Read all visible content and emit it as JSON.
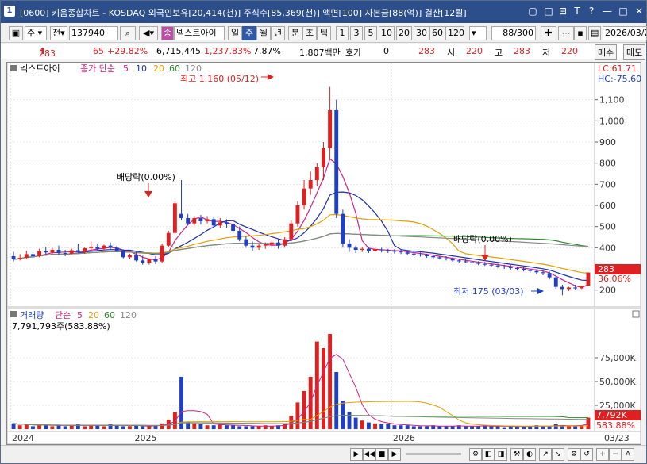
{
  "title_bar": {
    "window_number": "1",
    "title": "[0600] 키움종합차트 - KOSDAQ 외국인보유[20,414(천)] 주식수[85,369(천)] 액면[100] 자본금[88(억)] 결산[12월]",
    "buttons": [
      "▢",
      "□",
      "⊟",
      "T",
      "?",
      "—",
      "□",
      "✕"
    ]
  },
  "toolbar": {
    "type_label": "주",
    "market_label": "전",
    "code_value": "137940",
    "indicator_label": "종",
    "stock_name": "넥스트아이",
    "periods": [
      "일",
      "주",
      "월",
      "년",
      "분",
      "초",
      "틱"
    ],
    "selected_period": "주",
    "intervals": [
      "1",
      "3",
      "5",
      "10",
      "20",
      "30",
      "60",
      "120"
    ],
    "count_value": "88",
    "count_total": "/300",
    "date_value": "2026/03/2"
  },
  "quote_bar": {
    "price": "283",
    "change": "65",
    "change_pct": "+29.82%",
    "volume": "6,715,445",
    "volume_pct": "1,237.83%",
    "rate": "7.87%",
    "amount": "1,807백만",
    "hoga_label": "호가",
    "hoga_value": "0",
    "hoga_price": "283",
    "open_label": "시",
    "open_value": "220",
    "high_label": "고",
    "high_value": "283",
    "low_label": "저",
    "low_value": "220",
    "buy_label": "매수",
    "sell_label": "매도"
  },
  "price_panel": {
    "stock_label": "넥스트아이",
    "ma_label": "종가 단순",
    "ma_periods": [
      "5",
      "10",
      "20",
      "60",
      "120"
    ],
    "ma_colors": [
      "#cc2288",
      "#1b2fa8",
      "#e0a000",
      "#2a8a2a",
      "#888888"
    ],
    "high_annotation": "최고 1,160 (05/12)",
    "low_annotation": "최저 175 (03/03)",
    "dividend_annotation_1": "배당락(0.00%)",
    "dividend_annotation_2": "배당락(0.00%)",
    "lc_label": "LC:61.71",
    "hc_label": "HC:-75.60",
    "current_price": "283",
    "current_pct": "36.06%",
    "y_ticks": [
      "1,100",
      "1,000",
      "900",
      "800",
      "700",
      "600",
      "500",
      "400",
      "300",
      "200"
    ]
  },
  "volume_panel": {
    "label": "거래량",
    "ma_label": "단순",
    "ma_periods": [
      "5",
      "20",
      "60",
      "120"
    ],
    "volume_text": "7,791,793주(583.88%)",
    "y_ticks": [
      "75,000K",
      "50,000K",
      "25,000K"
    ],
    "current_volume": "7,792K",
    "current_pct": "583.88%"
  },
  "x_axis": {
    "labels": [
      "2024",
      "2025",
      "2026"
    ],
    "last_label": "03/23"
  },
  "chart_data": {
    "type": "candlestick",
    "x_labels": [
      "2024",
      "2025",
      "2026",
      "03/23"
    ],
    "ylim": [
      150,
      1200
    ],
    "price_ticks": [
      200,
      300,
      400,
      500,
      600,
      700,
      800,
      900,
      1000,
      1100
    ],
    "candles": [
      [
        0,
        360,
        380,
        345,
        335
      ],
      [
        1,
        345,
        370,
        352,
        340
      ],
      [
        2,
        352,
        385,
        370,
        345
      ],
      [
        3,
        370,
        380,
        360,
        350
      ],
      [
        4,
        360,
        395,
        385,
        355
      ],
      [
        5,
        385,
        405,
        378,
        370
      ],
      [
        6,
        378,
        400,
        390,
        370
      ],
      [
        7,
        390,
        410,
        375,
        365
      ],
      [
        8,
        375,
        390,
        372,
        360
      ],
      [
        9,
        372,
        395,
        388,
        368
      ],
      [
        10,
        388,
        420,
        380,
        375
      ],
      [
        11,
        380,
        400,
        398,
        372
      ],
      [
        12,
        398,
        430,
        405,
        390
      ],
      [
        13,
        405,
        420,
        395,
        385
      ],
      [
        14,
        395,
        415,
        410,
        388
      ],
      [
        15,
        410,
        425,
        400,
        392
      ],
      [
        16,
        400,
        410,
        385,
        378
      ],
      [
        17,
        385,
        392,
        355,
        350
      ],
      [
        18,
        355,
        372,
        365,
        345
      ],
      [
        19,
        365,
        380,
        340,
        335
      ],
      [
        20,
        340,
        362,
        330,
        320
      ],
      [
        21,
        330,
        350,
        345,
        320
      ],
      [
        22,
        345,
        360,
        335,
        322
      ],
      [
        23,
        335,
        420,
        410,
        330
      ],
      [
        24,
        410,
        480,
        470,
        405
      ],
      [
        25,
        470,
        620,
        610,
        465
      ],
      [
        26,
        560,
        720,
        540,
        530
      ],
      [
        27,
        540,
        560,
        515,
        505
      ],
      [
        28,
        515,
        550,
        540,
        505
      ],
      [
        29,
        540,
        555,
        525,
        510
      ],
      [
        30,
        525,
        550,
        535,
        515
      ],
      [
        31,
        535,
        545,
        505,
        495
      ],
      [
        32,
        505,
        540,
        520,
        495
      ],
      [
        33,
        520,
        535,
        510,
        495
      ],
      [
        34,
        510,
        520,
        480,
        470
      ],
      [
        35,
        480,
        500,
        440,
        430
      ],
      [
        36,
        440,
        455,
        410,
        400
      ],
      [
        37,
        410,
        430,
        400,
        385
      ],
      [
        38,
        400,
        420,
        410,
        390
      ],
      [
        39,
        410,
        425,
        415,
        395
      ],
      [
        40,
        415,
        440,
        425,
        405
      ],
      [
        41,
        425,
        440,
        410,
        395
      ],
      [
        42,
        410,
        450,
        440,
        400
      ],
      [
        43,
        440,
        530,
        515,
        430
      ],
      [
        44,
        515,
        620,
        600,
        500
      ],
      [
        45,
        600,
        720,
        680,
        580
      ],
      [
        46,
        680,
        760,
        720,
        650
      ],
      [
        47,
        720,
        800,
        780,
        690
      ],
      [
        48,
        780,
        900,
        870,
        720
      ],
      [
        49,
        870,
        1160,
        1050,
        820
      ],
      [
        50,
        1050,
        1100,
        560,
        540
      ],
      [
        51,
        560,
        580,
        420,
        400
      ],
      [
        52,
        420,
        440,
        400,
        380
      ],
      [
        53,
        400,
        410,
        390,
        375
      ],
      [
        54,
        390,
        405,
        395,
        380
      ],
      [
        55,
        395,
        405,
        385,
        375
      ],
      [
        56,
        385,
        400,
        392,
        378
      ],
      [
        57,
        392,
        400,
        388,
        378
      ],
      [
        58,
        388,
        395,
        385,
        375
      ],
      [
        59,
        385,
        393,
        382,
        372
      ],
      [
        60,
        382,
        390,
        378,
        370
      ],
      [
        61,
        378,
        386,
        372,
        365
      ],
      [
        62,
        372,
        380,
        368,
        360
      ],
      [
        63,
        368,
        378,
        365,
        358
      ],
      [
        64,
        365,
        372,
        360,
        352
      ],
      [
        65,
        360,
        368,
        355,
        348
      ],
      [
        66,
        355,
        362,
        350,
        344
      ],
      [
        67,
        350,
        360,
        346,
        340
      ],
      [
        68,
        346,
        355,
        340,
        334
      ],
      [
        69,
        340,
        348,
        336,
        330
      ],
      [
        70,
        336,
        345,
        332,
        326
      ],
      [
        71,
        332,
        340,
        328,
        322
      ],
      [
        72,
        328,
        336,
        324,
        318
      ],
      [
        73,
        324,
        333,
        320,
        314
      ],
      [
        74,
        320,
        328,
        316,
        310
      ],
      [
        75,
        316,
        325,
        312,
        305
      ],
      [
        76,
        312,
        320,
        308,
        300
      ],
      [
        77,
        308,
        318,
        304,
        296
      ],
      [
        78,
        304,
        312,
        300,
        292
      ],
      [
        79,
        300,
        308,
        295,
        288
      ],
      [
        80,
        295,
        302,
        290,
        282
      ],
      [
        81,
        290,
        298,
        284,
        276
      ],
      [
        82,
        284,
        292,
        280,
        270
      ],
      [
        83,
        280,
        288,
        260,
        250
      ],
      [
        84,
        260,
        272,
        215,
        205
      ],
      [
        85,
        215,
        225,
        205,
        175
      ],
      [
        86,
        205,
        215,
        212,
        195
      ],
      [
        87,
        212,
        225,
        208,
        200
      ],
      [
        88,
        208,
        220,
        220,
        205
      ],
      [
        89,
        220,
        283,
        283,
        220
      ]
    ],
    "volumes": [
      6,
      4,
      5,
      3,
      4,
      5,
      3,
      4,
      3,
      4,
      5,
      3,
      4,
      4,
      3,
      5,
      4,
      3,
      3,
      4,
      3,
      3,
      4,
      6,
      10,
      18,
      55,
      8,
      6,
      5,
      4,
      4,
      5,
      4,
      4,
      3,
      3,
      3,
      3,
      4,
      3,
      4,
      5,
      14,
      28,
      40,
      55,
      92,
      85,
      100,
      60,
      30,
      18,
      12,
      9,
      7,
      6,
      5,
      5,
      4,
      4,
      4,
      3,
      3,
      3,
      4,
      3,
      3,
      3,
      4,
      3,
      3,
      3,
      4,
      3,
      3,
      2,
      3,
      3,
      3,
      3,
      4,
      3,
      3,
      5,
      4,
      3,
      3,
      4,
      12
    ],
    "volume_unit": "K x 1000",
    "series": [
      {
        "name": "5",
        "color": "#cc2288"
      },
      {
        "name": "10",
        "color": "#1b2fa8"
      },
      {
        "name": "20",
        "color": "#e0a000"
      },
      {
        "name": "60",
        "color": "#2a8a2a"
      },
      {
        "name": "120",
        "color": "#888888"
      }
    ]
  }
}
